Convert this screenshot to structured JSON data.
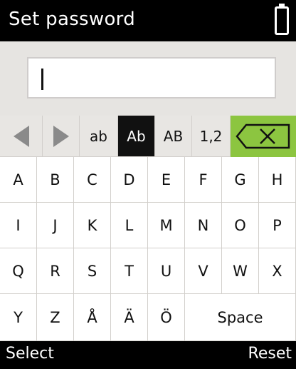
{
  "header": {
    "title": "Set password",
    "battery_icon": "battery-icon"
  },
  "password": {
    "value": ""
  },
  "toolbar": {
    "left_icon": "left-arrow-icon",
    "right_icon": "right-arrow-icon",
    "modes": [
      "ab",
      "Ab",
      "AB",
      "1,2"
    ],
    "active_mode": "Ab",
    "delete_icon": "backspace-icon",
    "colors": {
      "delete_bg": "#8cc540",
      "active_bg": "#111111"
    }
  },
  "keys": {
    "row1": [
      "A",
      "B",
      "C",
      "D",
      "E",
      "F",
      "G",
      "H"
    ],
    "row2": [
      "I",
      "J",
      "K",
      "L",
      "M",
      "N",
      "O",
      "P"
    ],
    "row3": [
      "Q",
      "R",
      "S",
      "T",
      "U",
      "V",
      "W",
      "X"
    ],
    "row4": [
      "Y",
      "Z",
      "Å",
      "Ä",
      "Ö"
    ],
    "space": "Space"
  },
  "softkeys": {
    "left": "Select",
    "right": "Reset"
  }
}
